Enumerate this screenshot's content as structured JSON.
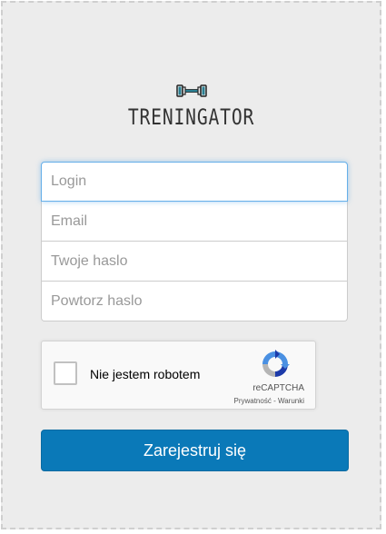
{
  "brand": {
    "name": "TRENINGATOR",
    "icon": "dumbbell-icon",
    "icon_color": "#2a7f92"
  },
  "form": {
    "login_placeholder": "Login",
    "email_placeholder": "Email",
    "password_placeholder": "Twoje haslo",
    "repeat_password_placeholder": "Powtorz haslo"
  },
  "recaptcha": {
    "checkbox_label": "Nie jestem robotem",
    "brand": "reCAPTCHA",
    "privacy_label": "Prywatność",
    "separator": " - ",
    "terms_label": "Warunki",
    "checked": false
  },
  "submit": {
    "label": "Zarejestruj się",
    "color": "#0a79b8"
  }
}
